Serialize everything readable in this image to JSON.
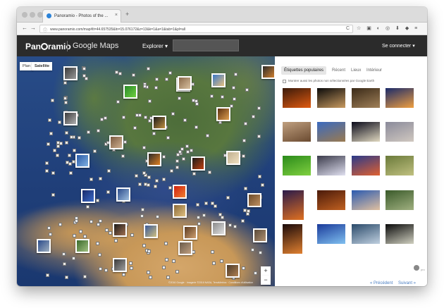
{
  "browser": {
    "tab_title": "Panoramio - Photos of the ...",
    "tab_close": "×",
    "new_tab": "+",
    "back": "←",
    "forward": "→",
    "info_icon": "ⓘ",
    "url": "www.panoramio.com/map#lt=44.657535&ln=15.076172&z=13&k=1&a=1&tab=1&pl=all",
    "reload": "C",
    "toolbar_icons": "☆ ▣ ◐ ◎ ⬇ ◆ ≡"
  },
  "header": {
    "logo_pre": "Pan",
    "logo_post": "ramio",
    "logo_divider": "|",
    "product": "Google Maps",
    "explorer": "Explorer ▾",
    "connect": "Se connecter ▾"
  },
  "map": {
    "type_plan": "Plan",
    "type_satellite": "Satellite",
    "zoom_in": "+",
    "zoom_out": "−",
    "footer": "©2016 Google · Imagerie ©2016 NASA, TerraMetrics · Conditions d'utilisation",
    "thumbs": [
      {
        "c1": "#3a3a3a",
        "c2": "#9a9a9a"
      },
      {
        "c1": "#5a3a28",
        "c2": "#e2a060"
      },
      {
        "c1": "#3a78c8",
        "c2": "#e6c080"
      },
      {
        "c1": "#2a2a2a",
        "c2": "#d08030"
      },
      {
        "c1": "#2a8a2a",
        "c2": "#70d040"
      },
      {
        "c1": "#8a6a4a",
        "c2": "#d8c0a0"
      },
      {
        "c1": "#3a3a3a",
        "c2": "#b0b0b0"
      },
      {
        "c1": "#1a1a1a",
        "c2": "#c09040"
      },
      {
        "c1": "#5a3010",
        "c2": "#e0a050"
      },
      {
        "c1": "#7a5a40",
        "c2": "#d0b090"
      },
      {
        "c1": "#2a2a2a",
        "c2": "#e08020"
      },
      {
        "c1": "#1a1a1a",
        "c2": "#c04010"
      },
      {
        "c1": "#c0b090",
        "c2": "#f0e0c0"
      },
      {
        "c1": "#2a5aa8",
        "c2": "#80b0e0"
      },
      {
        "c1": "#d02010",
        "c2": "#f08030"
      },
      {
        "c1": "#1a2a6a",
        "c2": "#3a6ac8"
      },
      {
        "c1": "#2a4a8a",
        "c2": "#a0c0e0"
      },
      {
        "c1": "#6a4a2a",
        "c2": "#c09060"
      },
      {
        "c1": "#3a6a2a",
        "c2": "#a0c080"
      },
      {
        "c1": "#8a6a3a",
        "c2": "#e0c080"
      },
      {
        "c1": "#3a5a9a",
        "c2": "#d0c080"
      },
      {
        "c1": "#1a1a1a",
        "c2": "#a07050"
      },
      {
        "c1": "#5a3a20",
        "c2": "#d0a070"
      },
      {
        "c1": "#8a8a8a",
        "c2": "#e0e0e0"
      },
      {
        "c1": "#2a4a8a",
        "c2": "#a0b0c0"
      },
      {
        "c1": "#5a4a3a",
        "c2": "#b09070"
      },
      {
        "c1": "#3a3a3a",
        "c2": "#a0a0a0"
      },
      {
        "c1": "#6a5a4a",
        "c2": "#c0a080"
      },
      {
        "c1": "#4a3a2a",
        "c2": "#b08050"
      }
    ]
  },
  "sidebar": {
    "tabs": [
      "Étiquettes populaires",
      "Récent",
      "Lieux",
      "Intérieur"
    ],
    "checkbox_label": "Montrer aussi les photos non sélectionnées par Google Earth",
    "photos": [
      {
        "c1": "#3a1a0a",
        "c2": "#e05a10"
      },
      {
        "c1": "#0a0a0a",
        "c2": "#c89a60"
      },
      {
        "c1": "#3a2a18",
        "c2": "#a08058"
      },
      {
        "c1": "#1a2a6a",
        "c2": "#f0a040"
      },
      {
        "c1": "#c0a080",
        "c2": "#6a4a30"
      },
      {
        "c1": "#3a6ac0",
        "c2": "#9a7a50"
      },
      {
        "c1": "#0a0a1a",
        "c2": "#e0d8c0"
      },
      {
        "c1": "#8a8a9a",
        "c2": "#d0c8c0"
      },
      {
        "c1": "#2a8a1a",
        "c2": "#80d040"
      },
      {
        "c1": "#3a3a4a",
        "c2": "#e0e0f0"
      },
      {
        "c1": "#2a3a8a",
        "c2": "#e06030"
      },
      {
        "c1": "#6a7a3a",
        "c2": "#c0c080"
      },
      {
        "c1": "#2a1a4a",
        "c2": "#e07020"
      },
      {
        "c1": "#4a1a0a",
        "c2": "#c06020"
      },
      {
        "c1": "#2a5ab0",
        "c2": "#e0c0a0"
      },
      {
        "c1": "#3a5a2a",
        "c2": "#a0b080"
      },
      {
        "c1": "#1a0a0a",
        "c2": "#e08030"
      },
      {
        "c1": "#1a3a9a",
        "c2": "#80c0f0"
      },
      {
        "c1": "#2a4a6a",
        "c2": "#c0d0e0"
      },
      {
        "c1": "#0a0a0a",
        "c2": "#d0d0c0"
      }
    ],
    "user_label": "pro",
    "prev": "« Précédent",
    "next": "Suivant »"
  }
}
